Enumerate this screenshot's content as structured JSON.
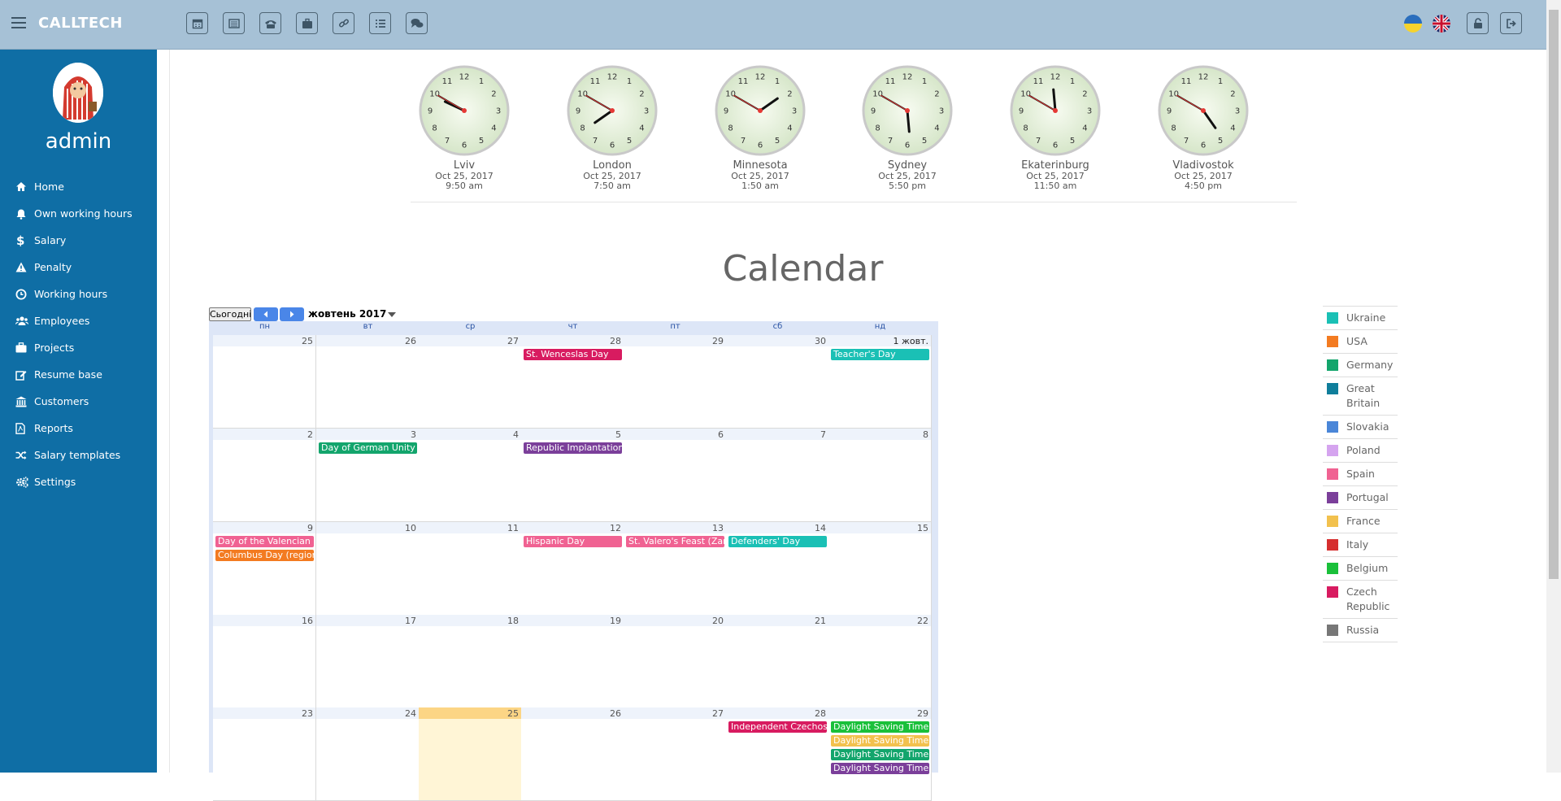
{
  "app": {
    "brand": "CALLTECH",
    "user": "admin"
  },
  "toolbar": {
    "buttons": [
      "calendar-icon",
      "list-alt-icon",
      "phone-icon",
      "briefcase-icon",
      "link-icon",
      "list-icon",
      "comments-icon"
    ],
    "right": [
      "ukraine-flag-icon",
      "uk-flag-icon",
      "unlock-icon",
      "logout-icon"
    ]
  },
  "sidebar": {
    "items": [
      {
        "label": "Home",
        "icon": "home-icon"
      },
      {
        "label": "Own working hours",
        "icon": "bell-icon"
      },
      {
        "label": "Salary",
        "icon": "dollar-icon"
      },
      {
        "label": "Penalty",
        "icon": "warning-icon"
      },
      {
        "label": "Working hours",
        "icon": "clock-icon"
      },
      {
        "label": "Employees",
        "icon": "users-icon"
      },
      {
        "label": "Projects",
        "icon": "briefcase-icon"
      },
      {
        "label": "Resume base",
        "icon": "edit-icon"
      },
      {
        "label": "Customers",
        "icon": "bank-icon"
      },
      {
        "label": "Reports",
        "icon": "file-pdf-icon"
      },
      {
        "label": "Salary templates",
        "icon": "random-icon"
      },
      {
        "label": "Settings",
        "icon": "cogs-icon"
      }
    ]
  },
  "clocks": [
    {
      "city": "Lviv",
      "date": "Oct 25, 2017",
      "time": "9:50 am",
      "h": 9,
      "m": 50
    },
    {
      "city": "London",
      "date": "Oct 25, 2017",
      "time": "7:50 am",
      "h": 7,
      "m": 50
    },
    {
      "city": "Minnesota",
      "date": "Oct 25, 2017",
      "time": "1:50 am",
      "h": 1,
      "m": 50
    },
    {
      "city": "Sydney",
      "date": "Oct 25, 2017",
      "time": "5:50 pm",
      "h": 5,
      "m": 50
    },
    {
      "city": "Ekaterinburg",
      "date": "Oct 25, 2017",
      "time": "11:50 am",
      "h": 11,
      "m": 50
    },
    {
      "city": "Vladivostok",
      "date": "Oct 25, 2017",
      "time": "4:50 pm",
      "h": 4,
      "m": 50
    }
  ],
  "page": {
    "title": "Calendar"
  },
  "calendar": {
    "today_label": "Сьогодні",
    "month_label": "жовтень 2017",
    "weekdays": [
      "пн",
      "вт",
      "ср",
      "чт",
      "пт",
      "сб",
      "нд"
    ],
    "weeks": [
      [
        "25",
        "26",
        "27",
        "28",
        "29",
        "30",
        "1 жовт."
      ],
      [
        "2",
        "3",
        "4",
        "5",
        "6",
        "7",
        "8"
      ],
      [
        "9",
        "10",
        "11",
        "12",
        "13",
        "14",
        "15"
      ],
      [
        "16",
        "17",
        "18",
        "19",
        "20",
        "21",
        "22"
      ],
      [
        "23",
        "24",
        "25",
        "26",
        "27",
        "28",
        "29"
      ]
    ],
    "today_cell": [
      4,
      2
    ],
    "events": [
      {
        "week": 0,
        "day": 3,
        "slot": 0,
        "title": "St. Wenceslas Day",
        "color": "#d81b60"
      },
      {
        "week": 0,
        "day": 6,
        "slot": 0,
        "title": "Teacher's Day",
        "color": "#1ac0b5"
      },
      {
        "week": 1,
        "day": 1,
        "slot": 0,
        "title": "Day of German Unity",
        "color": "#13a56c"
      },
      {
        "week": 1,
        "day": 3,
        "slot": 0,
        "title": "Republic Implantation",
        "color": "#7b3f9a"
      },
      {
        "week": 2,
        "day": 0,
        "slot": 0,
        "title": "Day of the Valencian Community",
        "color": "#f06292"
      },
      {
        "week": 2,
        "day": 0,
        "slot": 1,
        "title": "Columbus Day (regional)",
        "color": "#f37b21"
      },
      {
        "week": 2,
        "day": 3,
        "slot": 0,
        "title": "Hispanic Day",
        "color": "#f06292"
      },
      {
        "week": 2,
        "day": 4,
        "slot": 0,
        "title": "St. Valero's Feast (Zaragoza)",
        "color": "#f06292"
      },
      {
        "week": 2,
        "day": 5,
        "slot": 0,
        "title": "Defenders' Day",
        "color": "#1ac0b5"
      },
      {
        "week": 4,
        "day": 5,
        "slot": 0,
        "title": "Independent Czechoslovak State Day",
        "color": "#d81b60"
      },
      {
        "week": 4,
        "day": 6,
        "slot": 0,
        "title": "Daylight Saving Time",
        "color": "#1ac03a"
      },
      {
        "week": 4,
        "day": 6,
        "slot": 1,
        "title": "Daylight Saving Time",
        "color": "#f2c14e"
      },
      {
        "week": 4,
        "day": 6,
        "slot": 2,
        "title": "Daylight Saving Time",
        "color": "#13a56c"
      },
      {
        "week": 4,
        "day": 6,
        "slot": 3,
        "title": "Daylight Saving Time",
        "color": "#7b3f9a"
      }
    ]
  },
  "legend": [
    {
      "label": "Ukraine",
      "color": "#1ac0b5"
    },
    {
      "label": "USA",
      "color": "#f37b21"
    },
    {
      "label": "Germany",
      "color": "#13a56c"
    },
    {
      "label": "Great Britain",
      "color": "#0f7e9b"
    },
    {
      "label": "Slovakia",
      "color": "#4a86d8"
    },
    {
      "label": "Poland",
      "color": "#d5a4ef"
    },
    {
      "label": "Spain",
      "color": "#f06292"
    },
    {
      "label": "Portugal",
      "color": "#7b3f9a"
    },
    {
      "label": "France",
      "color": "#f2c14e"
    },
    {
      "label": "Italy",
      "color": "#d62f2f"
    },
    {
      "label": "Belgium",
      "color": "#1ac03a"
    },
    {
      "label": "Czech Republic",
      "color": "#d81b60"
    },
    {
      "label": "Russia",
      "color": "#777777"
    }
  ]
}
